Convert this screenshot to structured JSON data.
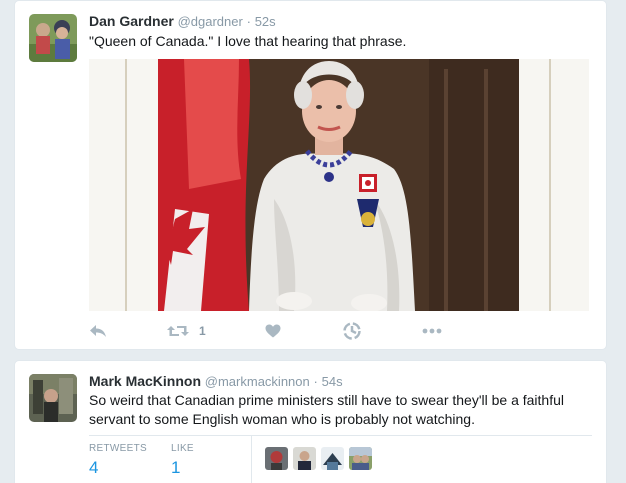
{
  "tweets": [
    {
      "fullname": "Dan Gardner",
      "username": "@dgardner",
      "separator": "·",
      "time": "52s",
      "text": "\"Queen of Canada.\" I love that hearing that phrase.",
      "media_alt": "Portrait of the Queen in a white gown beside a Canadian flag",
      "actions": {
        "reply_icon": "reply-icon",
        "retweet_icon": "retweet-icon",
        "retweet_count": "1",
        "like_icon": "heart-icon",
        "moments_icon": "moments-icon",
        "more_icon": "more-icon"
      }
    },
    {
      "fullname": "Mark MacKinnon",
      "username": "@markmackinnon",
      "separator": "·",
      "time": "54s",
      "text": "So weird that Canadian prime ministers still have to swear they'll be a faithful servant to some English woman who is probably not watching.",
      "stats": {
        "retweets_label": "RETWEETS",
        "retweets_count": "4",
        "likes_label": "LIKE",
        "likes_count": "1"
      }
    }
  ],
  "colors": {
    "background": "#e6ecf0",
    "link_blue": "#1b95e0",
    "muted": "#8899a6",
    "action_icon": "#aab8c2"
  }
}
